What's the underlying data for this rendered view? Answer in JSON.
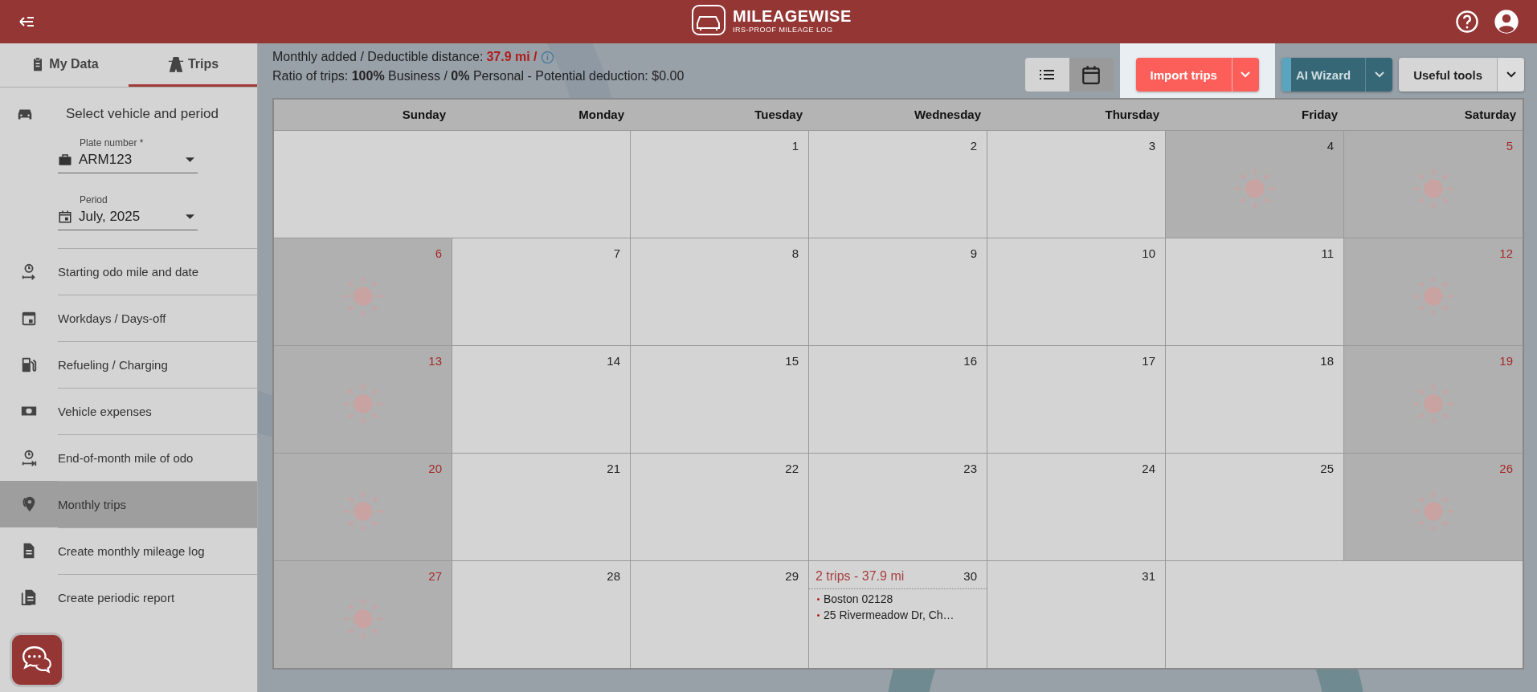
{
  "header": {
    "logo_title": "MILEAGEWISE",
    "logo_subtitle": "IRS-PROOF MILEAGE LOG"
  },
  "sidebar": {
    "tabs": [
      {
        "label": "My Data",
        "selected": false
      },
      {
        "label": "Trips",
        "selected": true
      }
    ],
    "section_title": "Select vehicle and period",
    "fields": [
      {
        "label": "Plate number *",
        "value": "ARM123"
      },
      {
        "label": "Period",
        "value": "July, 2025"
      }
    ],
    "items": [
      {
        "label": "Starting odo mile and date",
        "selected": false
      },
      {
        "label": "Workdays / Days-off",
        "selected": false
      },
      {
        "label": "Refueling / Charging",
        "selected": false
      },
      {
        "label": "Vehicle expenses",
        "selected": false
      },
      {
        "label": "End-of-month mile of odo",
        "selected": false
      },
      {
        "label": "Monthly trips",
        "selected": true
      },
      {
        "label": "Create monthly mileage log",
        "selected": false
      },
      {
        "label": "Create periodic report",
        "selected": false
      }
    ]
  },
  "summary": {
    "distance_label": "Monthly added / Deductible distance:",
    "distance_value": "37.9 mi /",
    "ratio": "Ratio of trips: **100%** Business / **0%** Personal - Potential deduction: $0.00"
  },
  "toolbar": {
    "views": [
      {
        "selected": false
      },
      {
        "selected": true
      }
    ],
    "buttons": [
      {
        "label": "Import trips",
        "kind": "import",
        "highlighted": true
      },
      {
        "label": "AI Wizard",
        "kind": "wizard",
        "highlighted": false
      },
      {
        "label": "Useful tools",
        "kind": "tools",
        "highlighted": false
      }
    ]
  },
  "calendar": {
    "weekdays": [
      "Sunday",
      "Monday",
      "Tuesday",
      "Wednesday",
      "Thursday",
      "Friday",
      "Saturday"
    ],
    "weeks": [
      [
        {
          "kind": "blank"
        },
        {
          "kind": "blank"
        },
        {
          "day": "1",
          "kind": "workday"
        },
        {
          "day": "2",
          "kind": "workday"
        },
        {
          "day": "3",
          "kind": "workday"
        },
        {
          "day": "4",
          "kind": "holiday"
        },
        {
          "day": "5",
          "kind": "weekend"
        }
      ],
      [
        {
          "day": "6",
          "kind": "weekend"
        },
        {
          "day": "7",
          "kind": "workday"
        },
        {
          "day": "8",
          "kind": "workday"
        },
        {
          "day": "9",
          "kind": "workday"
        },
        {
          "day": "10",
          "kind": "workday"
        },
        {
          "day": "11",
          "kind": "workday"
        },
        {
          "day": "12",
          "kind": "weekend"
        }
      ],
      [
        {
          "day": "13",
          "kind": "weekend"
        },
        {
          "day": "14",
          "kind": "workday"
        },
        {
          "day": "15",
          "kind": "workday"
        },
        {
          "day": "16",
          "kind": "workday"
        },
        {
          "day": "17",
          "kind": "workday"
        },
        {
          "day": "18",
          "kind": "workday"
        },
        {
          "day": "19",
          "kind": "weekend"
        }
      ],
      [
        {
          "day": "20",
          "kind": "weekend"
        },
        {
          "day": "21",
          "kind": "workday"
        },
        {
          "day": "22",
          "kind": "workday"
        },
        {
          "day": "23",
          "kind": "workday"
        },
        {
          "day": "24",
          "kind": "workday"
        },
        {
          "day": "25",
          "kind": "workday"
        },
        {
          "day": "26",
          "kind": "weekend"
        }
      ],
      [
        {
          "day": "27",
          "kind": "weekend"
        },
        {
          "day": "28",
          "kind": "workday"
        },
        {
          "day": "29",
          "kind": "workday"
        },
        {
          "day": "30",
          "kind": "workday",
          "trip_summary": "2 trips - 37.9 mi",
          "trips": [
            "Boston 02128",
            "25 Rivermeadow Dr, Ch…"
          ]
        },
        {
          "day": "31",
          "kind": "workday"
        },
        {
          "kind": "blank"
        },
        {
          "kind": "blank"
        }
      ]
    ]
  }
}
